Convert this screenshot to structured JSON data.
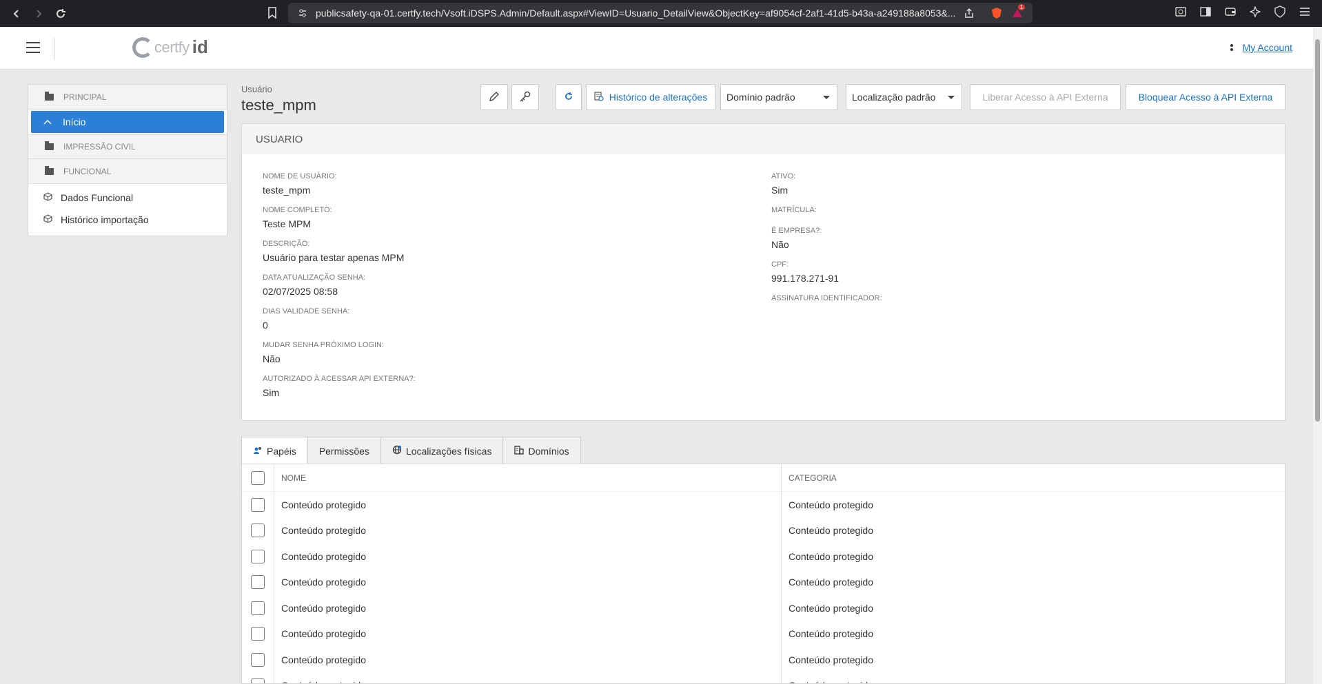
{
  "browser": {
    "url": "publicsafety-qa-01.certfy.tech/Vsoft.iDSPS.Admin/Default.aspx#ViewID=Usuario_DetailView&ObjectKey=af9054cf-2af1-41d5-b43a-a249188a8053&...",
    "badge_count": "1"
  },
  "header": {
    "logo_text": "certfy",
    "logo_id": "id",
    "account_link": "My Account"
  },
  "sidebar": {
    "groups": [
      {
        "label": "PRINCIPAL"
      },
      {
        "label": "IMPRESSÃO CIVIL"
      },
      {
        "label": "FUNCIONAL"
      }
    ],
    "active_item": "Início",
    "items": [
      "Dados Funcional",
      "Histórico importação"
    ]
  },
  "page": {
    "caption": "Usuário",
    "title": "teste_mpm"
  },
  "toolbar": {
    "history_label": "Histórico de alterações",
    "domain_select": "Domínio padrão",
    "location_select": "Localização padrão",
    "grant_api_label": "Liberar Acesso à API Externa",
    "block_api_label": "Bloquear Acesso à API Externa"
  },
  "panel": {
    "title": "USUARIO",
    "left_fields": [
      {
        "label": "NOME DE USUÁRIO:",
        "value": "teste_mpm"
      },
      {
        "label": "NOME COMPLETO:",
        "value": "Teste MPM"
      },
      {
        "label": "DESCRIÇÃO:",
        "value": "Usuário para testar apenas MPM"
      },
      {
        "label": "DATA ATUALIZAÇÃO SENHA:",
        "value": "02/07/2025 08:58"
      },
      {
        "label": "DIAS VALIDADE SENHA:",
        "value": "0"
      },
      {
        "label": "MUDAR SENHA PRÓXIMO LOGIN:",
        "value": "Não"
      },
      {
        "label": "AUTORIZADO À ACESSAR API EXTERNA?:",
        "value": "Sim"
      }
    ],
    "right_fields": [
      {
        "label": "ATIVO:",
        "value": "Sim"
      },
      {
        "label": "MATRÍCULA:",
        "value": ""
      },
      {
        "label": "É EMPRESA?:",
        "value": "Não"
      },
      {
        "label": "CPF:",
        "value": "991.178.271-91"
      },
      {
        "label": "ASSINATURA IDENTIFICADOR:",
        "value": ""
      }
    ]
  },
  "tabs": [
    {
      "label": "Papéis",
      "icon": "roles-icon"
    },
    {
      "label": "Permissões",
      "icon": ""
    },
    {
      "label": "Localizações físicas",
      "icon": "globe-icon"
    },
    {
      "label": "Domínios",
      "icon": "building-icon"
    }
  ],
  "grid": {
    "columns": [
      "NOME",
      "CATEGORIA"
    ],
    "rows": [
      [
        "Conteúdo protegido",
        "Conteúdo protegido"
      ],
      [
        "Conteúdo protegido",
        "Conteúdo protegido"
      ],
      [
        "Conteúdo protegido",
        "Conteúdo protegido"
      ],
      [
        "Conteúdo protegido",
        "Conteúdo protegido"
      ],
      [
        "Conteúdo protegido",
        "Conteúdo protegido"
      ],
      [
        "Conteúdo protegido",
        "Conteúdo protegido"
      ],
      [
        "Conteúdo protegido",
        "Conteúdo protegido"
      ],
      [
        "Conteúdo protegido",
        "Conteúdo protegido"
      ]
    ]
  },
  "colors": {
    "accent": "#2b7fd6",
    "link": "#1a73c8"
  }
}
